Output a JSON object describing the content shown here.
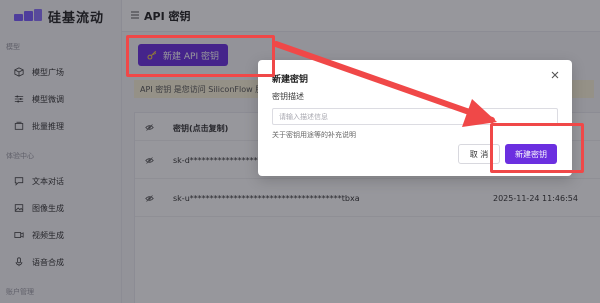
{
  "sidebar": {
    "brand": "硅基流动",
    "sections": [
      {
        "title": "模型",
        "items": [
          {
            "label": "模型广场",
            "icon": "cube-icon"
          },
          {
            "label": "模型微调",
            "icon": "sliders-icon"
          },
          {
            "label": "批量推理",
            "icon": "stack-icon"
          }
        ]
      },
      {
        "title": "体验中心",
        "items": [
          {
            "label": "文本对话",
            "icon": "chat-icon"
          },
          {
            "label": "图像生成",
            "icon": "image-icon"
          },
          {
            "label": "视频生成",
            "icon": "video-icon"
          },
          {
            "label": "语音合成",
            "icon": "mic-icon"
          }
        ]
      },
      {
        "title": "账户管理",
        "items": []
      }
    ]
  },
  "header": {
    "title": "API 密钥"
  },
  "main": {
    "new_key_button": "新建 API 密钥",
    "notice": "API 密钥 是您访问 SiliconFlow 服",
    "table": {
      "header": {
        "key_col": "密钥(点击复制)"
      },
      "rows": [
        {
          "key": "sk-d**********************",
          "created": ""
        },
        {
          "key": "sk-u**************************************tbxa",
          "created": "2025-11-24 11:46:54"
        }
      ]
    }
  },
  "modal": {
    "title": "新建密钥",
    "field_label": "密钥描述",
    "input_placeholder": "请输入描述信息",
    "input_value": "",
    "helper_text": "关于密钥用途等的补充说明",
    "cancel_label": "取 消",
    "create_label": "新建密钥"
  },
  "colors": {
    "accent": "#6b2fe0",
    "annotation": "#f04848",
    "notice_bg": "#fbf5d9"
  }
}
